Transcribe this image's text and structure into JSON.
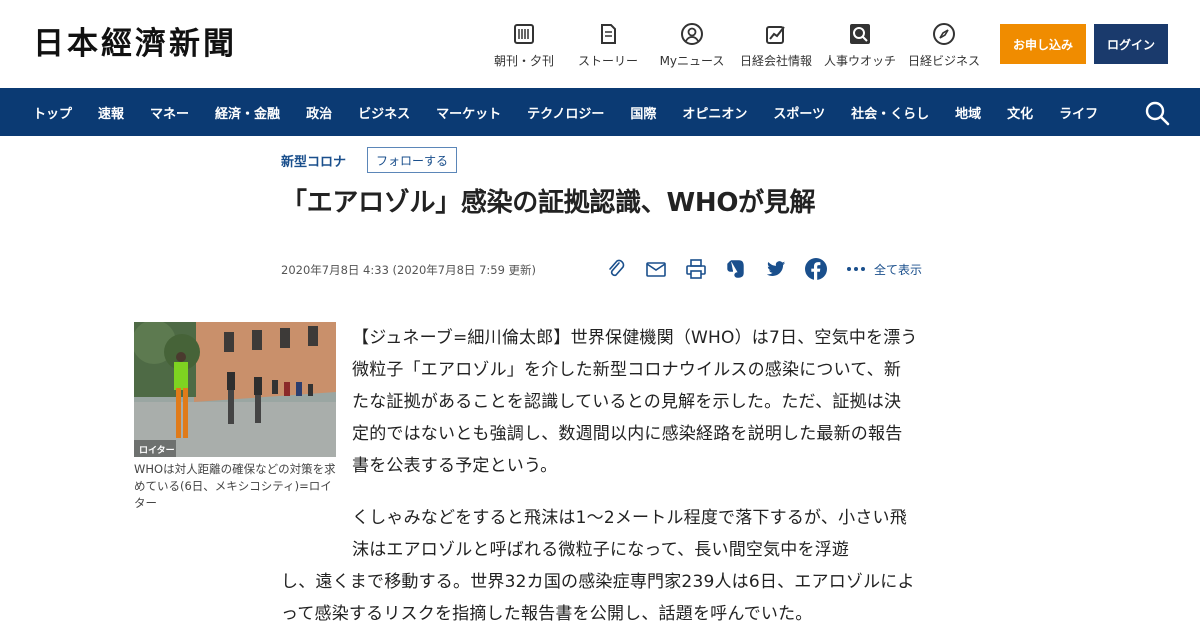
{
  "header": {
    "logo": "日本經濟新聞",
    "nav": [
      {
        "label": "朝刊・夕刊",
        "icon": "newspaper-icon"
      },
      {
        "label": "ストーリー",
        "icon": "story-icon"
      },
      {
        "label": "Myニュース",
        "icon": "user-icon"
      },
      {
        "label": "日経会社情報",
        "icon": "chart-icon"
      },
      {
        "label": "人事ウオッチ",
        "icon": "search-person-icon"
      },
      {
        "label": "日経ビジネス",
        "icon": "compass-icon"
      }
    ],
    "subscribe_label": "お申し込み",
    "login_label": "ログイン",
    "subscribe_color": "#f08c00",
    "login_color": "#1a3a6c"
  },
  "category_nav": {
    "items": [
      "トップ",
      "速報",
      "マネー",
      "経済・金融",
      "政治",
      "ビジネス",
      "マーケット",
      "テクノロジー",
      "国際",
      "オピニオン",
      "スポーツ",
      "社会・くらし",
      "地域",
      "文化",
      "ライフ"
    ],
    "background": "#0b3a73"
  },
  "article": {
    "topic": "新型コロナ",
    "follow_label": "フォローする",
    "title": "「エアロゾル」感染の証拠認識、WHOが見解",
    "date": "2020年7月8日 4:33 (2020年7月8日 7:59 更新)",
    "share_all_label": "全て表示",
    "share_icons": [
      "clip-icon",
      "mail-icon",
      "print-icon",
      "evernote-icon",
      "twitter-icon",
      "facebook-icon",
      "more-icon"
    ],
    "photo_credit": "ロイター",
    "photo_caption": "WHOは対人距離の確保などの対策を求めている(6日、メキシコシティ)=ロイター",
    "paragraph1": "【ジュネーブ=細川倫太郎】世界保健機関（WHO）は7日、空気中を漂う微粒子「エアロゾル」を介した新型コロナウイルスの感染について、新たな証拠があることを認識しているとの見解を示した。ただ、証拠は決定的ではないとも強調し、数週間以内に感染経路を説明した最新の報告書を公表する予定という。",
    "paragraph2a": "くしゃみなどをすると飛沫は1～2メートル程度で落下するが、小さい飛沫はエアロゾルと呼ばれる微粒子になって、長い間空気中を浮遊",
    "paragraph2b": "し、遠くまで移動する。世界32カ国の感染症専門家239人は6日、エアロゾルによって感染するリスクを指摘した報告書を公開し、話題を呼んでいた。"
  }
}
